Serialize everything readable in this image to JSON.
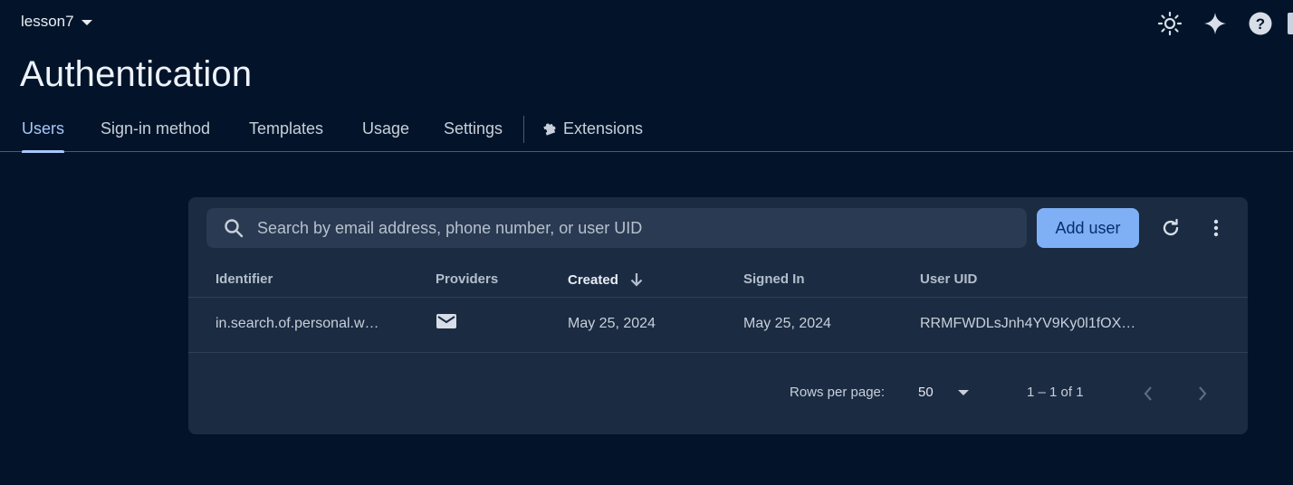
{
  "header": {
    "project_name": "lesson7",
    "icons": [
      "theme-toggle-icon",
      "gemini-sparkle-icon",
      "help-icon"
    ]
  },
  "page": {
    "title": "Authentication"
  },
  "tabs": [
    {
      "label": "Users",
      "active": true
    },
    {
      "label": "Sign-in method"
    },
    {
      "label": "Templates"
    },
    {
      "label": "Usage"
    },
    {
      "label": "Settings"
    },
    {
      "label": "Extensions",
      "icon": "puzzle-icon"
    }
  ],
  "toolbar": {
    "search_placeholder": "Search by email address, phone number, or user UID",
    "add_user_label": "Add user",
    "refresh_icon": "refresh-icon",
    "more_icon": "more-vert-icon"
  },
  "table": {
    "columns": [
      "Identifier",
      "Providers",
      "Created",
      "Signed In",
      "User UID"
    ],
    "sort_column": "Created",
    "sort_direction": "descending",
    "rows": [
      {
        "identifier": "in.search.of.personal.w…",
        "provider_icon": "email-icon",
        "created": "May 25, 2024",
        "signed_in": "May 25, 2024",
        "uid": "RRMFWDLsJnh4YV9Ky0l1fOX…"
      }
    ]
  },
  "pagination": {
    "rows_per_page_label": "Rows per page:",
    "rows_per_page_value": "50",
    "range_label": "1 – 1 of 1"
  },
  "colors": {
    "background": "#03142a",
    "card": "#1b2b42",
    "accent": "#a8c7fa",
    "primary_button": "#7fb0f5"
  }
}
